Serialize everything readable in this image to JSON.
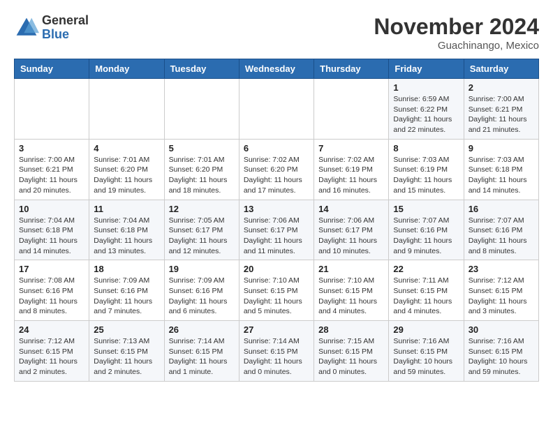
{
  "header": {
    "logo": {
      "general": "General",
      "blue": "Blue"
    },
    "title": "November 2024",
    "subtitle": "Guachinango, Mexico"
  },
  "calendar": {
    "headers": [
      "Sunday",
      "Monday",
      "Tuesday",
      "Wednesday",
      "Thursday",
      "Friday",
      "Saturday"
    ],
    "weeks": [
      [
        {
          "day": "",
          "info": ""
        },
        {
          "day": "",
          "info": ""
        },
        {
          "day": "",
          "info": ""
        },
        {
          "day": "",
          "info": ""
        },
        {
          "day": "",
          "info": ""
        },
        {
          "day": "1",
          "info": "Sunrise: 6:59 AM\nSunset: 6:22 PM\nDaylight: 11 hours\nand 22 minutes."
        },
        {
          "day": "2",
          "info": "Sunrise: 7:00 AM\nSunset: 6:21 PM\nDaylight: 11 hours\nand 21 minutes."
        }
      ],
      [
        {
          "day": "3",
          "info": "Sunrise: 7:00 AM\nSunset: 6:21 PM\nDaylight: 11 hours\nand 20 minutes."
        },
        {
          "day": "4",
          "info": "Sunrise: 7:01 AM\nSunset: 6:20 PM\nDaylight: 11 hours\nand 19 minutes."
        },
        {
          "day": "5",
          "info": "Sunrise: 7:01 AM\nSunset: 6:20 PM\nDaylight: 11 hours\nand 18 minutes."
        },
        {
          "day": "6",
          "info": "Sunrise: 7:02 AM\nSunset: 6:20 PM\nDaylight: 11 hours\nand 17 minutes."
        },
        {
          "day": "7",
          "info": "Sunrise: 7:02 AM\nSunset: 6:19 PM\nDaylight: 11 hours\nand 16 minutes."
        },
        {
          "day": "8",
          "info": "Sunrise: 7:03 AM\nSunset: 6:19 PM\nDaylight: 11 hours\nand 15 minutes."
        },
        {
          "day": "9",
          "info": "Sunrise: 7:03 AM\nSunset: 6:18 PM\nDaylight: 11 hours\nand 14 minutes."
        }
      ],
      [
        {
          "day": "10",
          "info": "Sunrise: 7:04 AM\nSunset: 6:18 PM\nDaylight: 11 hours\nand 14 minutes."
        },
        {
          "day": "11",
          "info": "Sunrise: 7:04 AM\nSunset: 6:18 PM\nDaylight: 11 hours\nand 13 minutes."
        },
        {
          "day": "12",
          "info": "Sunrise: 7:05 AM\nSunset: 6:17 PM\nDaylight: 11 hours\nand 12 minutes."
        },
        {
          "day": "13",
          "info": "Sunrise: 7:06 AM\nSunset: 6:17 PM\nDaylight: 11 hours\nand 11 minutes."
        },
        {
          "day": "14",
          "info": "Sunrise: 7:06 AM\nSunset: 6:17 PM\nDaylight: 11 hours\nand 10 minutes."
        },
        {
          "day": "15",
          "info": "Sunrise: 7:07 AM\nSunset: 6:16 PM\nDaylight: 11 hours\nand 9 minutes."
        },
        {
          "day": "16",
          "info": "Sunrise: 7:07 AM\nSunset: 6:16 PM\nDaylight: 11 hours\nand 8 minutes."
        }
      ],
      [
        {
          "day": "17",
          "info": "Sunrise: 7:08 AM\nSunset: 6:16 PM\nDaylight: 11 hours\nand 8 minutes."
        },
        {
          "day": "18",
          "info": "Sunrise: 7:09 AM\nSunset: 6:16 PM\nDaylight: 11 hours\nand 7 minutes."
        },
        {
          "day": "19",
          "info": "Sunrise: 7:09 AM\nSunset: 6:16 PM\nDaylight: 11 hours\nand 6 minutes."
        },
        {
          "day": "20",
          "info": "Sunrise: 7:10 AM\nSunset: 6:15 PM\nDaylight: 11 hours\nand 5 minutes."
        },
        {
          "day": "21",
          "info": "Sunrise: 7:10 AM\nSunset: 6:15 PM\nDaylight: 11 hours\nand 4 minutes."
        },
        {
          "day": "22",
          "info": "Sunrise: 7:11 AM\nSunset: 6:15 PM\nDaylight: 11 hours\nand 4 minutes."
        },
        {
          "day": "23",
          "info": "Sunrise: 7:12 AM\nSunset: 6:15 PM\nDaylight: 11 hours\nand 3 minutes."
        }
      ],
      [
        {
          "day": "24",
          "info": "Sunrise: 7:12 AM\nSunset: 6:15 PM\nDaylight: 11 hours\nand 2 minutes."
        },
        {
          "day": "25",
          "info": "Sunrise: 7:13 AM\nSunset: 6:15 PM\nDaylight: 11 hours\nand 2 minutes."
        },
        {
          "day": "26",
          "info": "Sunrise: 7:14 AM\nSunset: 6:15 PM\nDaylight: 11 hours\nand 1 minute."
        },
        {
          "day": "27",
          "info": "Sunrise: 7:14 AM\nSunset: 6:15 PM\nDaylight: 11 hours\nand 0 minutes."
        },
        {
          "day": "28",
          "info": "Sunrise: 7:15 AM\nSunset: 6:15 PM\nDaylight: 11 hours\nand 0 minutes."
        },
        {
          "day": "29",
          "info": "Sunrise: 7:16 AM\nSunset: 6:15 PM\nDaylight: 10 hours\nand 59 minutes."
        },
        {
          "day": "30",
          "info": "Sunrise: 7:16 AM\nSunset: 6:15 PM\nDaylight: 10 hours\nand 59 minutes."
        }
      ]
    ]
  }
}
